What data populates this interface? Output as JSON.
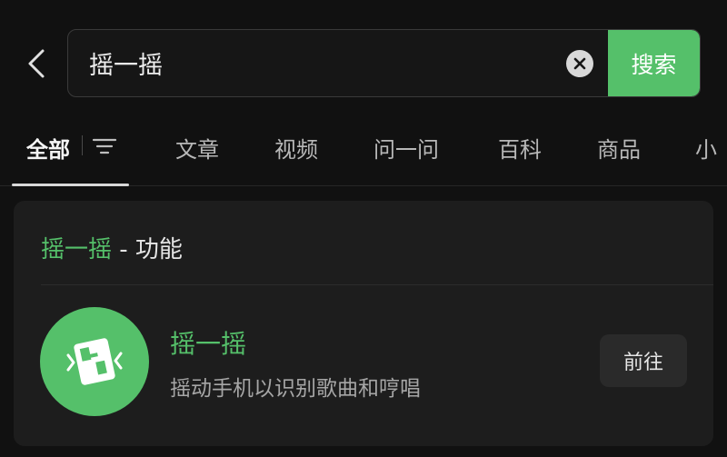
{
  "header": {
    "back_icon": "chevron-left-icon",
    "search": {
      "value": "摇一摇",
      "placeholder": "",
      "clear_icon": "clear-icon",
      "button_label": "搜索"
    }
  },
  "tabs": [
    {
      "label": "全部",
      "active": true
    },
    {
      "label": "文章"
    },
    {
      "label": "视频"
    },
    {
      "label": "问一问"
    },
    {
      "label": "百科"
    },
    {
      "label": "商品"
    },
    {
      "label": "小"
    }
  ],
  "filter_icon": "filter-icon",
  "result_card": {
    "header_highlight": "摇一摇",
    "header_suffix": " - 功能",
    "item": {
      "icon": "shake-icon",
      "title": "摇一摇",
      "description": "摇动手机以识别歌曲和哼唱",
      "action_label": "前往"
    }
  },
  "colors": {
    "accent": "#55c06a",
    "background": "#111111",
    "card": "#1d1d1d"
  }
}
